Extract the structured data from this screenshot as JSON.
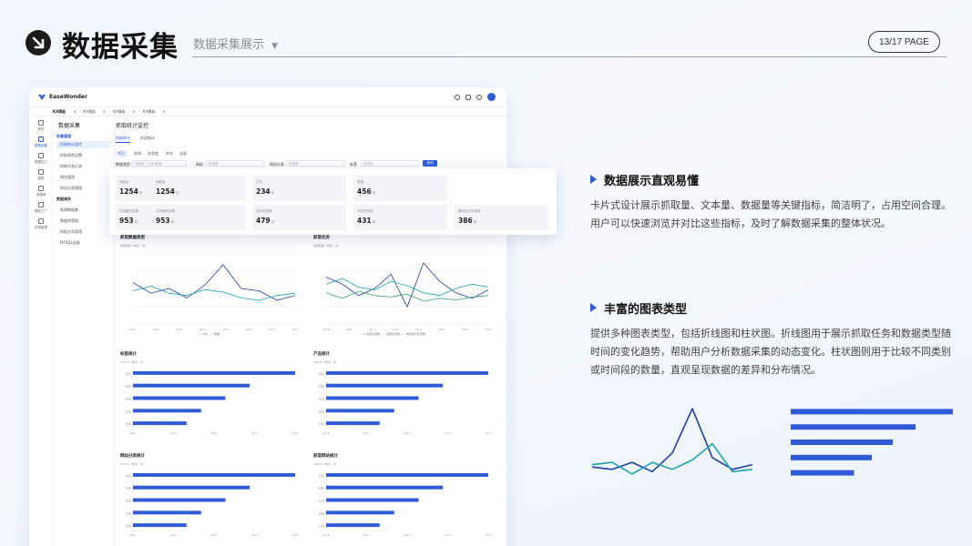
{
  "header": {
    "title": "数据采集",
    "subtitle": "数据采集展示",
    "page": "13/17 PAGE"
  },
  "app": {
    "brand": "EaseWonder",
    "tabs": [
      "KX模板",
      "KX模板",
      "KX模板",
      "KX模板"
    ],
    "rail": [
      "首页",
      "数据采集",
      "数据加工",
      "报表",
      "资源库",
      "模板工厂",
      "系统管理"
    ],
    "menu_title": "数据采集",
    "menu": {
      "group1": "采集管理",
      "selected": "抓取统计监控",
      "items1": [
        "抓取规则设置",
        "抓取任务记录",
        "域名管理",
        "网站分类管理"
      ],
      "group2": "数据清洗",
      "items2": [
        "新建数据集",
        "数据库管理",
        "抓取文本管理",
        "MYSQL连接"
      ]
    },
    "main_title": "抓取统计监控",
    "subtabs": [
      "抓取统计",
      "任务统计"
    ],
    "time_pills": [
      "今天",
      "本周",
      "本季度",
      "本年",
      "全部"
    ],
    "filters": [
      {
        "label": "数据类型",
        "placeholder": "请选择（文本/数据）"
      },
      {
        "label": "网站",
        "placeholder": "请选择"
      },
      {
        "label": "网站分类",
        "placeholder": "请选择"
      },
      {
        "label": "标签",
        "placeholder": "请选择"
      }
    ],
    "query_button": "查询",
    "bg_cards": [
      {
        "label": "抓取量",
        "value": "1254",
        "unit": "条"
      },
      {
        "label": "抓取量",
        "value": "1254",
        "unit": "条"
      },
      {
        "label": "文本",
        "value": "234",
        "unit": "条"
      },
      {
        "label": "数据",
        "value": "456",
        "unit": "条"
      },
      {
        "label": "总抓取任务数",
        "value": "953",
        "unit": "条"
      },
      {
        "label": "总抓取任务数",
        "value": "953",
        "unit": "条"
      },
      {
        "label": "成功任务数",
        "value": "479",
        "unit": "条"
      },
      {
        "label": "失败任务数",
        "value": "431",
        "unit": "条"
      },
      {
        "label": "等待运行任务数",
        "value": "386",
        "unit": "条"
      }
    ],
    "overlay_cards": [
      {
        "label": "抓取量",
        "value": "1254",
        "unit": "条"
      },
      {
        "label": "抓取量",
        "value": "1254",
        "unit": "条"
      },
      {
        "label": "文本",
        "value": "234",
        "unit": "条"
      },
      {
        "label": "数据",
        "value": "456",
        "unit": "条"
      },
      {
        "label": "总抓取任务数",
        "value": "953",
        "unit": "条"
      },
      {
        "label": "总抓取任务数",
        "value": "953",
        "unit": "条"
      },
      {
        "label": "成功任务数",
        "value": "479",
        "unit": "条"
      },
      {
        "label": "失败任务数",
        "value": "431",
        "unit": "条"
      },
      {
        "label": "等待运行任务数",
        "value": "386",
        "unit": "条"
      }
    ],
    "sections": [
      {
        "title": "抓取数据类型",
        "sub": "抓取数量（单位：条）",
        "legend": [
          "文本",
          "数据"
        ]
      },
      {
        "title": "抓取任务",
        "sub": "抓取数量（单位：条）",
        "legend": [
          "成功任务数",
          "失败任务数",
          "等待运行任务数"
        ]
      },
      {
        "title": "标签统计",
        "sub": "TOP10（单位：条）"
      },
      {
        "title": "产品统计",
        "sub": "TOP10（单位：条）"
      },
      {
        "title": "网站分类统计",
        "sub": "TOP10（单位：条）"
      },
      {
        "title": "抓取网站统计",
        "sub": "TOP10（单位：条）"
      }
    ],
    "x_ticks": [
      "Apr1",
      "Apr1",
      "Apr1",
      "Apr1",
      "Apr1",
      "Apr1",
      "Apr1",
      "Apr1"
    ],
    "bar_cats": [
      "标签",
      "标签",
      "标签",
      "标签",
      "标签"
    ]
  },
  "mini_lines": {
    "type": "line",
    "series": [
      {
        "values": [
          63,
          58,
          50,
          55,
          65,
          42,
          73,
          60,
          52,
          48,
          54
        ]
      },
      {
        "values": [
          58,
          62,
          56,
          54,
          60,
          57,
          52,
          50,
          55,
          58,
          56
        ]
      },
      {
        "values": [
          52,
          48,
          53,
          50,
          49,
          51,
          46,
          48,
          47,
          49,
          50
        ]
      }
    ]
  },
  "mini_lines_2": {
    "series": [
      {
        "values": [
          65,
          56,
          60,
          52,
          63,
          80,
          60,
          58,
          50,
          54
        ]
      },
      {
        "values": [
          58,
          62,
          56,
          54,
          59,
          57,
          52,
          50,
          54,
          56
        ]
      }
    ]
  },
  "mini_bars": {
    "values": [
      100,
      72,
      57,
      42,
      33
    ]
  },
  "feature1": {
    "title": "数据展示直观易懂",
    "text": "卡片式设计展示抓取量、文本量、数据量等关键指标，简洁明了，占用空间合理。用户可以快速浏览并对比这些指标，及时了解数据采集的整体状况。"
  },
  "feature2": {
    "title": "丰富的图表类型",
    "text": "提供多种图表类型，包括折线图和柱状图。折线图用于展示抓取任务和数据类型随时间的变化趋势，帮助用户分析数据采集的动态变化。柱状图则用于比较不同类别或时间段的数量，直观呈现数据的差异和分布情况。"
  },
  "deco_line": {
    "type": "line",
    "series": [
      {
        "values": [
          10,
          8,
          14,
          6,
          22,
          60,
          18,
          8,
          12
        ]
      },
      {
        "values": [
          12,
          14,
          4,
          14,
          8,
          16,
          30,
          6,
          8
        ]
      }
    ]
  },
  "deco_bars": {
    "values": [
      100,
      77,
      63,
      50,
      39
    ]
  },
  "colors": {
    "accent": "#2f5bd8",
    "dark_blue": "#1f3fa8",
    "teal": "#1aa3b8"
  }
}
